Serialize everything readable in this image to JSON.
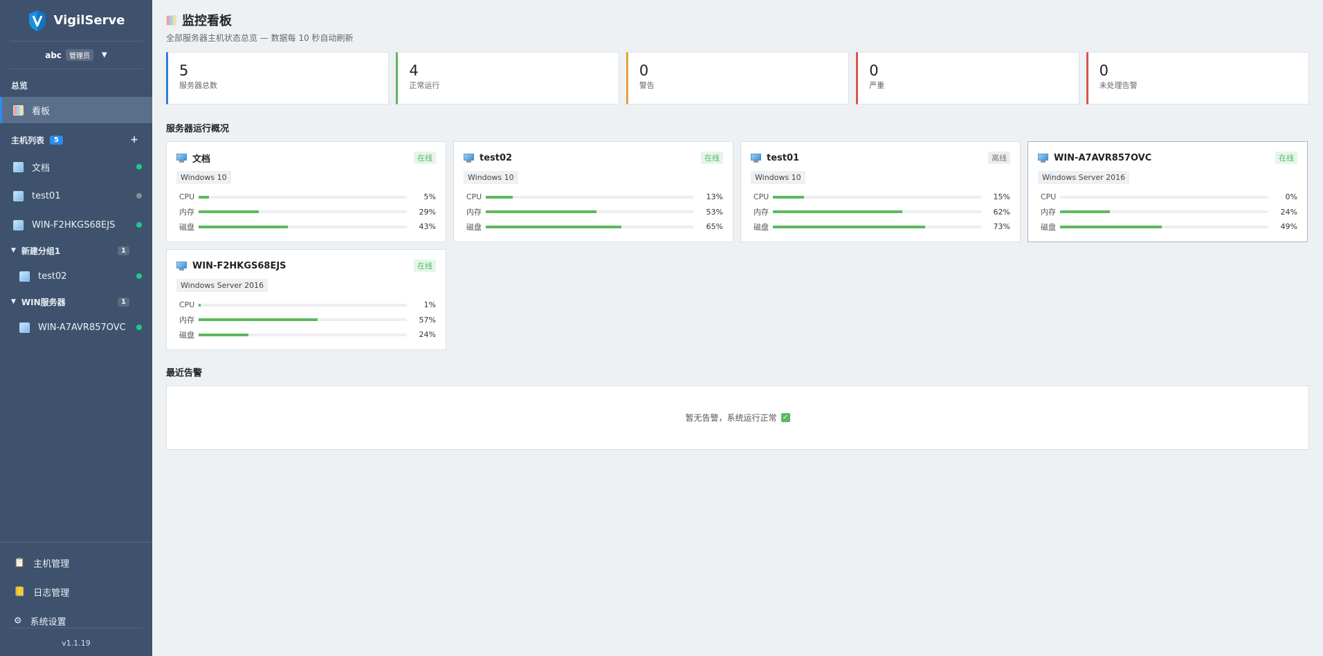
{
  "app": {
    "name": "VigilServe",
    "version": "v1.1.19"
  },
  "user": {
    "name": "abc",
    "role": "管理员"
  },
  "sidebar": {
    "overview_title": "总览",
    "dashboard_label": "看板",
    "hosts_title": "主机列表",
    "hosts_count": "5",
    "hosts": [
      {
        "label": "文档",
        "status": "online"
      },
      {
        "label": "test01",
        "status": "offline"
      },
      {
        "label": "WIN-F2HKGS68EJS",
        "status": "online"
      }
    ],
    "groups": [
      {
        "label": "新建分组1",
        "count": "1",
        "hosts": [
          {
            "label": "test02",
            "status": "online"
          }
        ]
      },
      {
        "label": "WIN服务器",
        "count": "1",
        "hosts": [
          {
            "label": "WIN-A7AVR857OVC",
            "status": "online"
          }
        ]
      }
    ],
    "bottom": [
      {
        "label": "主机管理",
        "icon": "clipboard-icon"
      },
      {
        "label": "日志管理",
        "icon": "notebook-icon"
      },
      {
        "label": "系统设置",
        "icon": "gear-icon"
      }
    ]
  },
  "header": {
    "title": "监控看板",
    "subtitle": "全部服务器主机状态总览 — 数据每 10 秒自动刷新"
  },
  "stats": [
    {
      "value": "5",
      "label": "服务器总数",
      "color": "#2d7fd8"
    },
    {
      "value": "4",
      "label": "正常运行",
      "color": "#5cb85c"
    },
    {
      "value": "0",
      "label": "警告",
      "color": "#e6a23c"
    },
    {
      "value": "0",
      "label": "严重",
      "color": "#d9534f"
    },
    {
      "value": "0",
      "label": "未处理告警",
      "color": "#d9534f"
    }
  ],
  "servers_title": "服务器运行概况",
  "metric_labels": {
    "cpu": "CPU",
    "mem": "内存",
    "disk": "磁盘"
  },
  "servers": [
    {
      "name": "文档",
      "os": "Windows 10",
      "status": "在线",
      "online": true,
      "cpu": "5%",
      "mem": "29%",
      "disk": "43%"
    },
    {
      "name": "test02",
      "os": "Windows 10",
      "status": "在线",
      "online": true,
      "cpu": "13%",
      "mem": "53%",
      "disk": "65%"
    },
    {
      "name": "test01",
      "os": "Windows 10",
      "status": "离线",
      "online": false,
      "cpu": "15%",
      "mem": "62%",
      "disk": "73%"
    },
    {
      "name": "WIN-A7AVR857OVC",
      "os": "Windows Server 2016",
      "status": "在线",
      "online": true,
      "cpu": "0%",
      "mem": "24%",
      "disk": "49%"
    },
    {
      "name": "WIN-F2HKGS68EJS",
      "os": "Windows Server 2016",
      "status": "在线",
      "online": true,
      "cpu": "1%",
      "mem": "57%",
      "disk": "24%"
    }
  ],
  "alerts": {
    "title": "最近告警",
    "empty_text": "暂无告警，系统运行正常"
  },
  "colors": {
    "online": "#1fc98e",
    "offline": "#8a8f96",
    "bar": "#5cb85c",
    "accent": "#2d8cf0"
  }
}
